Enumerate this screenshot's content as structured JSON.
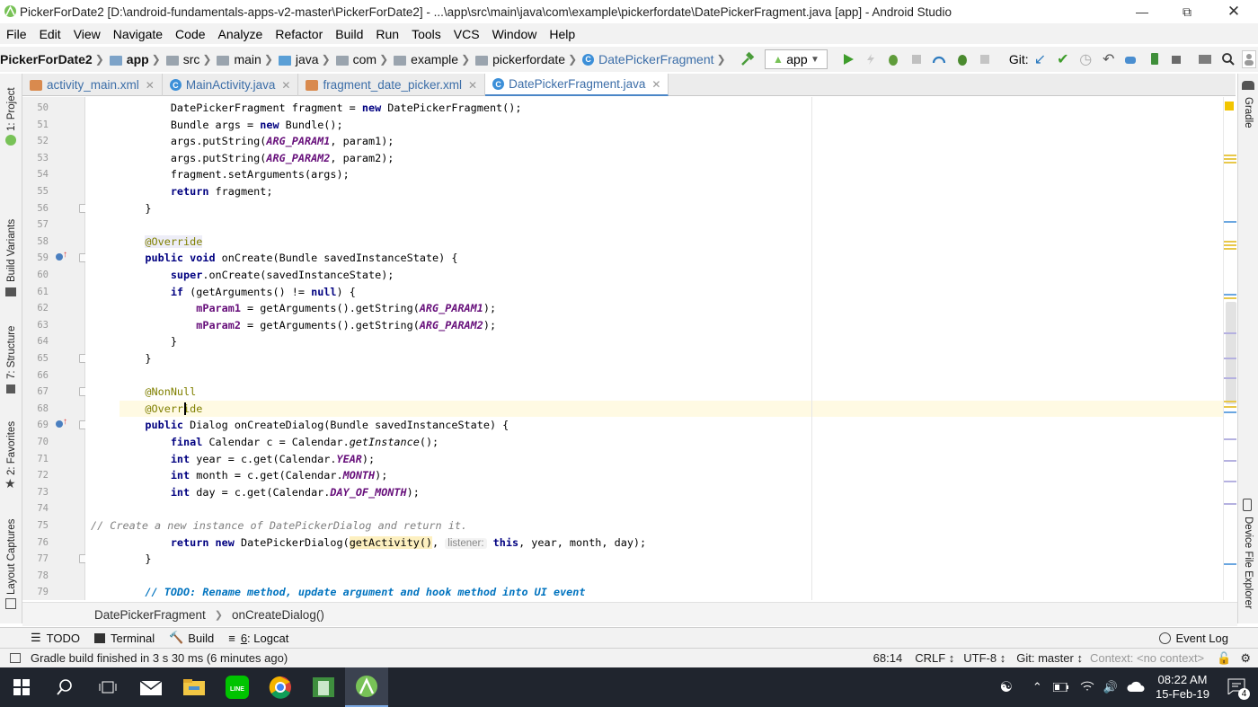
{
  "window": {
    "title": "PickerForDate2 [D:\\android-fundamentals-apps-v2-master\\PickerForDate2] - ...\\app\\src\\main\\java\\com\\example\\pickerfordate\\DatePickerFragment.java [app] - Android Studio"
  },
  "menu": [
    "File",
    "Edit",
    "View",
    "Navigate",
    "Code",
    "Analyze",
    "Refactor",
    "Build",
    "Run",
    "Tools",
    "VCS",
    "Window",
    "Help"
  ],
  "breadcrumbs": {
    "project": "PickerForDate2",
    "module": "app",
    "src": "src",
    "main": "main",
    "java": "java",
    "com": "com",
    "example": "example",
    "pkg": "pickerfordate",
    "cls": "DatePickerFragment"
  },
  "toolbar": {
    "run_config": "app",
    "git_label": "Git:"
  },
  "tabs": [
    {
      "label": "activity_main.xml",
      "kind": "xml"
    },
    {
      "label": "MainActivity.java",
      "kind": "class"
    },
    {
      "label": "fragment_date_picker.xml",
      "kind": "xml"
    },
    {
      "label": "DatePickerFragment.java",
      "kind": "class",
      "active": true
    }
  ],
  "left_tools": {
    "project": "1: Project",
    "build_variants": "Build Variants",
    "structure": "7: Structure",
    "favorites": "2: Favorites",
    "layout_captures": "Layout Captures"
  },
  "right_tools": {
    "gradle": "Gradle",
    "device_explorer": "Device File Explorer"
  },
  "code": [
    {
      "n": "50",
      "segs": [
        [
          "        DatePickerFragment fragment = ",
          ""
        ],
        [
          "new",
          "kw"
        ],
        [
          " DatePickerFragment();",
          ""
        ]
      ]
    },
    {
      "n": "51",
      "segs": [
        [
          "        Bundle args = ",
          ""
        ],
        [
          "new",
          "kw"
        ],
        [
          " Bundle();",
          ""
        ]
      ]
    },
    {
      "n": "52",
      "segs": [
        [
          "        args.putString(",
          ""
        ],
        [
          "ARG_PARAM1",
          "cst"
        ],
        [
          ", param1);",
          ""
        ]
      ]
    },
    {
      "n": "53",
      "segs": [
        [
          "        args.putString(",
          ""
        ],
        [
          "ARG_PARAM2",
          "cst"
        ],
        [
          ", param2);",
          ""
        ]
      ]
    },
    {
      "n": "54",
      "segs": [
        [
          "        fragment.setArguments(args);",
          ""
        ]
      ]
    },
    {
      "n": "55",
      "segs": [
        [
          "        ",
          ""
        ],
        [
          "return",
          "kw"
        ],
        [
          " fragment;",
          ""
        ]
      ]
    },
    {
      "n": "56",
      "segs": [
        [
          "    }",
          ""
        ]
      ]
    },
    {
      "n": "57",
      "segs": [
        [
          "",
          ""
        ]
      ]
    },
    {
      "n": "58",
      "segs": [
        [
          "    ",
          ""
        ],
        [
          "@Override",
          "ann"
        ]
      ]
    },
    {
      "n": "59",
      "segs": [
        [
          "    ",
          ""
        ],
        [
          "public void",
          "kw"
        ],
        [
          " onCreate(Bundle savedInstanceState) {",
          ""
        ]
      ]
    },
    {
      "n": "60",
      "segs": [
        [
          "        ",
          ""
        ],
        [
          "super",
          "kw"
        ],
        [
          ".onCreate(savedInstanceState);",
          ""
        ]
      ]
    },
    {
      "n": "61",
      "segs": [
        [
          "        ",
          ""
        ],
        [
          "if",
          "kw"
        ],
        [
          " (getArguments() != ",
          ""
        ],
        [
          "null",
          "kw"
        ],
        [
          ") {",
          ""
        ]
      ]
    },
    {
      "n": "62",
      "segs": [
        [
          "            ",
          ""
        ],
        [
          "mParam1",
          "cst2"
        ],
        [
          " = getArguments().getString(",
          ""
        ],
        [
          "ARG_PARAM1",
          "cst"
        ],
        [
          ");",
          ""
        ]
      ]
    },
    {
      "n": "63",
      "segs": [
        [
          "            ",
          ""
        ],
        [
          "mParam2",
          "cst2"
        ],
        [
          " = getArguments().getString(",
          ""
        ],
        [
          "ARG_PARAM2",
          "cst"
        ],
        [
          ");",
          ""
        ]
      ]
    },
    {
      "n": "64",
      "segs": [
        [
          "        }",
          ""
        ]
      ]
    },
    {
      "n": "65",
      "segs": [
        [
          "    }",
          ""
        ]
      ]
    },
    {
      "n": "66",
      "segs": [
        [
          "",
          ""
        ]
      ]
    },
    {
      "n": "67",
      "segs": [
        [
          "    ",
          ""
        ],
        [
          "@NonNull",
          "ann"
        ]
      ]
    },
    {
      "n": "68",
      "segs": [
        [
          "    ",
          ""
        ],
        [
          "@Override",
          "ann"
        ]
      ]
    },
    {
      "n": "69",
      "segs": [
        [
          "    ",
          ""
        ],
        [
          "public",
          "kw"
        ],
        [
          " Dialog onCreateDialog(Bundle savedInstanceState) {",
          ""
        ]
      ]
    },
    {
      "n": "70",
      "segs": [
        [
          "        ",
          ""
        ],
        [
          "final",
          "kw"
        ],
        [
          " Calendar c = Calendar.",
          ""
        ],
        [
          "getInstance",
          "ital"
        ],
        [
          "();",
          ""
        ]
      ]
    },
    {
      "n": "71",
      "segs": [
        [
          "        ",
          ""
        ],
        [
          "int",
          "kw"
        ],
        [
          " year = c.get(Calendar.",
          ""
        ],
        [
          "YEAR",
          "cst"
        ],
        [
          ");",
          ""
        ]
      ]
    },
    {
      "n": "72",
      "segs": [
        [
          "        ",
          ""
        ],
        [
          "int",
          "kw"
        ],
        [
          " month = c.get(Calendar.",
          ""
        ],
        [
          "MONTH",
          "cst"
        ],
        [
          ");",
          ""
        ]
      ]
    },
    {
      "n": "73",
      "segs": [
        [
          "        ",
          ""
        ],
        [
          "int",
          "kw"
        ],
        [
          " day = c.get(Calendar.",
          ""
        ],
        [
          "DAY_OF_MONTH",
          "cst"
        ],
        [
          ");",
          ""
        ]
      ]
    },
    {
      "n": "74",
      "segs": [
        [
          "",
          ""
        ]
      ]
    },
    {
      "n": "75",
      "segs": [
        [
          "// Create a new instance of DatePickerDialog and return it.",
          "cmt"
        ]
      ]
    },
    {
      "n": "76",
      "segs": [
        [
          "        ",
          ""
        ],
        [
          "return new",
          "kw"
        ],
        [
          " DatePickerDialog(",
          ""
        ],
        [
          "getActivity()",
          "hl"
        ],
        [
          ", ",
          ""
        ],
        [
          "listener:",
          "hint"
        ],
        [
          " ",
          ""
        ],
        [
          "this",
          "kw"
        ],
        [
          ", year, month, day);",
          ""
        ]
      ]
    },
    {
      "n": "77",
      "segs": [
        [
          "    }",
          ""
        ]
      ]
    },
    {
      "n": "78",
      "segs": [
        [
          "",
          ""
        ]
      ]
    },
    {
      "n": "79",
      "segs": [
        [
          "    ",
          ""
        ],
        [
          "// TODO: Rename method, update argument and hook method into UI event",
          "todo"
        ]
      ]
    }
  ],
  "editor_breadcrumb": {
    "cls": "DatePickerFragment",
    "method": "onCreateDialog()"
  },
  "tool_windows": {
    "todo": "TODO",
    "terminal": "Terminal",
    "build": "Build",
    "logcat_num": "6",
    "logcat": ": Logcat",
    "event_log": "Event Log"
  },
  "status": {
    "message": "Gradle build finished in 3 s 30 ms (6 minutes ago)",
    "position": "68:14",
    "line_sep": "CRLF",
    "encoding": "UTF-8",
    "git": "Git: master",
    "context": "Context: <no context>"
  },
  "taskbar": {
    "time": "08:22 AM",
    "date": "15-Feb-19",
    "notif_count": "4"
  },
  "colors": {
    "keyword": "#000080",
    "constant": "#660e7a",
    "annotation": "#808000",
    "comment": "#808080",
    "todo": "#0073bf",
    "link": "#3c6ea8"
  }
}
